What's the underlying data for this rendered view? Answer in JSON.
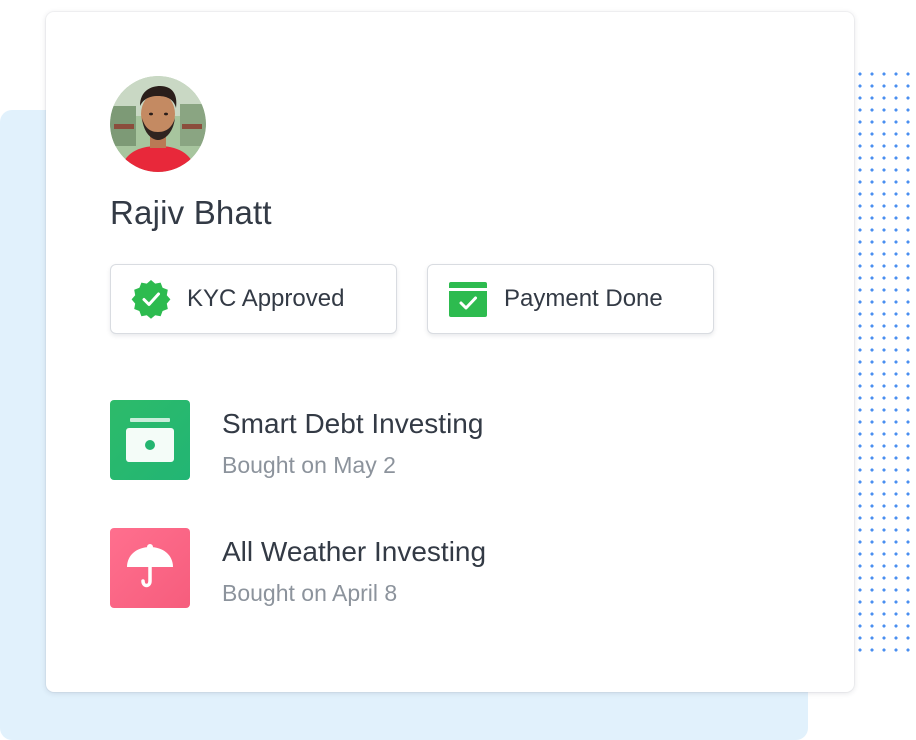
{
  "profile": {
    "name": "Rajiv Bhatt"
  },
  "badges": [
    {
      "label": "KYC Approved",
      "icon": "verified-badge-icon",
      "color": "#2dbb4f"
    },
    {
      "label": "Payment Done",
      "icon": "payment-card-icon",
      "color": "#2dbb4f"
    }
  ],
  "products": [
    {
      "title": "Smart Debt Investing",
      "subtitle": "Bought on May 2",
      "icon": "wallet-icon",
      "color": "#26b86f"
    },
    {
      "title": "All Weather Investing",
      "subtitle": "Bought on April 8",
      "icon": "umbrella-icon",
      "color": "#fb6584"
    }
  ],
  "colors": {
    "background_accent": "#e1f1fc",
    "dots": "#4a8ff0",
    "text_primary": "#333a45",
    "text_secondary": "#8c939c"
  }
}
